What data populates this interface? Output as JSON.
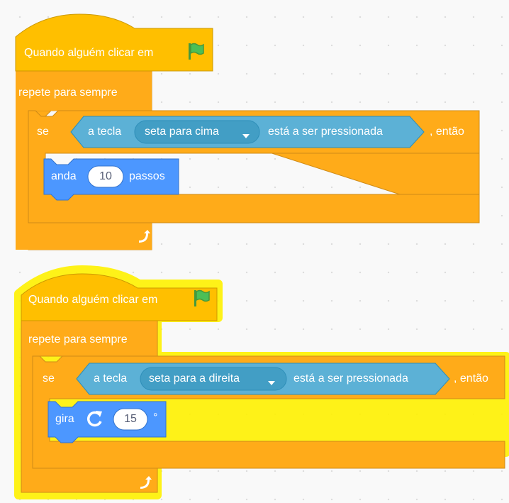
{
  "script1": {
    "hat": "Quando alguém clicar em",
    "forever": "repete para sempre",
    "if_label": "se",
    "key_prefix": "a tecla",
    "key_value": "seta para cima",
    "key_suffix": "está a ser pressionada",
    "then": ", então",
    "move_label": "anda",
    "move_value": "10",
    "move_suffix": "passos"
  },
  "script2": {
    "hat": "Quando alguém clicar em",
    "forever": "repete para sempre",
    "if_label": "se",
    "key_prefix": "a tecla",
    "key_value": "seta para a direita",
    "key_suffix": "está a ser pressionada",
    "then": ", então",
    "turn_label": "gira",
    "turn_value": "15",
    "turn_suffix": "°"
  },
  "colors": {
    "events": "#FFBF00",
    "control": "#FFAB19",
    "sensing": "#5CB1D6",
    "motion": "#4C97FF",
    "glow": "#FFF200"
  },
  "icons": [
    "green-flag-icon",
    "dropdown-arrow-icon",
    "rotate-clockwise-icon",
    "loop-arrow-icon"
  ]
}
